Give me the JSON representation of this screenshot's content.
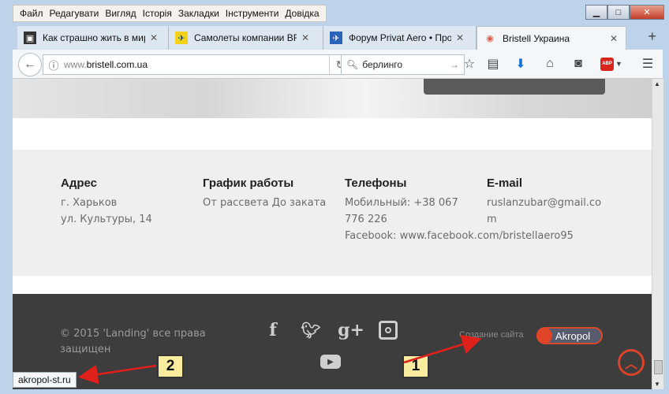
{
  "menu": [
    "Файл",
    "Редагувати",
    "Вигляд",
    "Історія",
    "Закладки",
    "Інструменти",
    "Довідка"
  ],
  "tabs": [
    {
      "title": "Как страшно жить в мире",
      "icon": "photo-favicon-icon"
    },
    {
      "title": "Самолеты компании BR",
      "icon": "plane-favicon-icon"
    },
    {
      "title": "Форум Privat Aero • Про",
      "icon": "forum-favicon-icon"
    },
    {
      "title": "Bristell Украина",
      "icon": "bristell-favicon-icon",
      "active": true
    }
  ],
  "address": {
    "prefix": "www.",
    "domain": "bristell.com.ua"
  },
  "search": {
    "value": "берлинго"
  },
  "contacts": {
    "address": {
      "heading": "Адрес",
      "line1": "г. Харьков",
      "line2": "ул. Культуры, 14"
    },
    "schedule": {
      "heading": "График работы",
      "line1": "От рассвета До заката"
    },
    "phones": {
      "heading": "Телефоны",
      "line1": "Мобильный: +38 067",
      "line2": "776 226",
      "line3": "Facebook: www.facebook.com/bristellaero95"
    },
    "email": {
      "heading": "E-mail",
      "line1": "ruslanzubar@gmail.co",
      "line2": "m"
    }
  },
  "footer": {
    "copyright": "© 2015 'Landing' все права защищен",
    "credit": "Создание сайта",
    "brand": "Akropol"
  },
  "status_url": "akropol-st.ru",
  "annotations": {
    "badge1": "1",
    "badge2": "2"
  },
  "colors": {
    "accent": "#d9452c",
    "footer_bg": "#3d3d3d",
    "contacts_bg": "#efefef"
  }
}
